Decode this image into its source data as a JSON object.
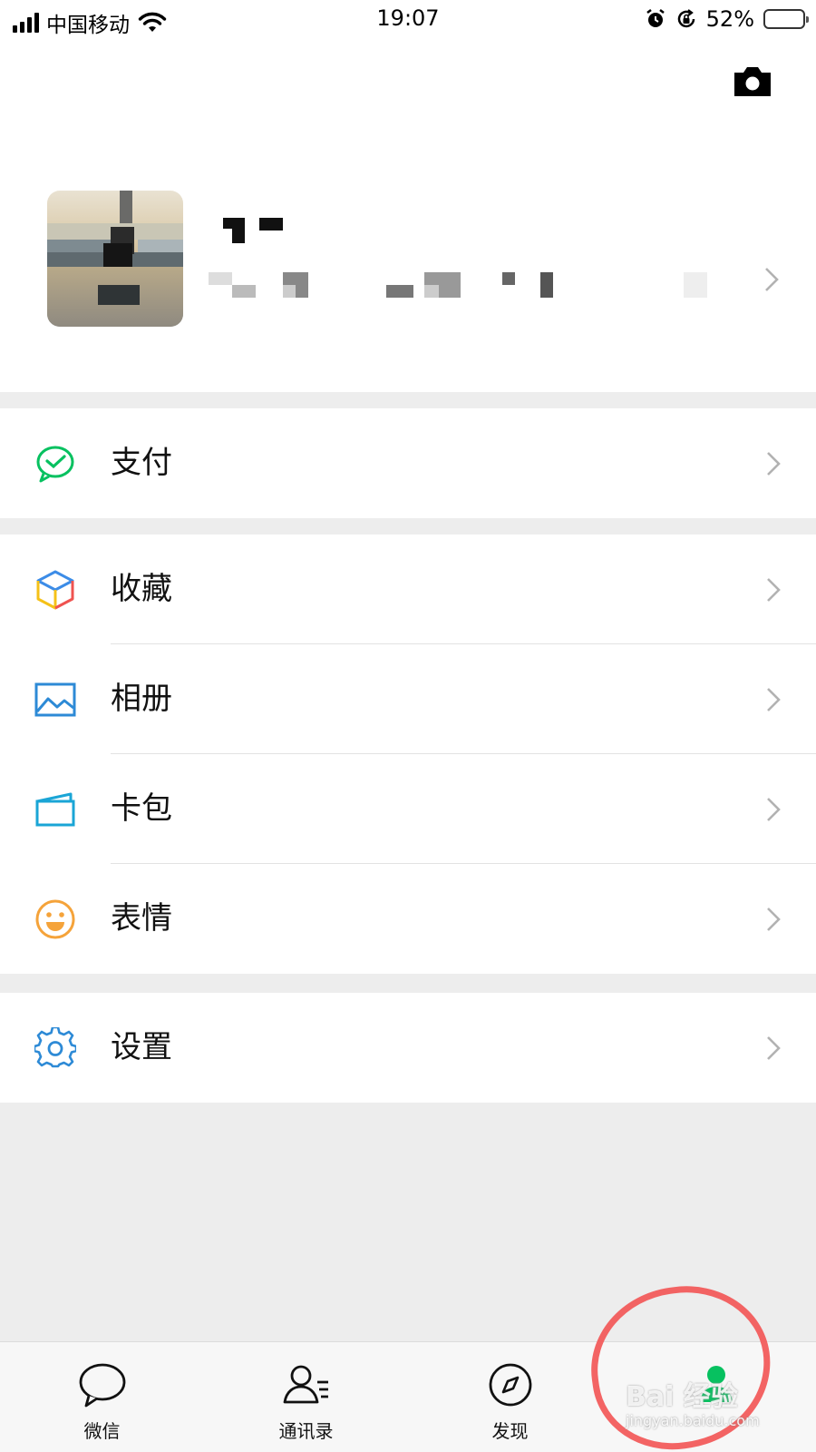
{
  "status_bar": {
    "carrier": "中国移动",
    "time": "19:07",
    "battery": "52%",
    "battery_level": 0.52
  },
  "profile": {
    "name": "",
    "wechat_id": ""
  },
  "menu": {
    "pay": "支付",
    "favorites": "收藏",
    "album": "相册",
    "cards": "卡包",
    "stickers": "表情",
    "settings": "设置"
  },
  "tabs": {
    "chats": "微信",
    "contacts": "通讯录",
    "discover": "发现",
    "me": "我"
  },
  "watermark": {
    "text": "Bai 经验",
    "url": "jingyan.baidu.com"
  },
  "colors": {
    "wechat_green": "#07c160",
    "annotation_red": "#f25c5c"
  }
}
